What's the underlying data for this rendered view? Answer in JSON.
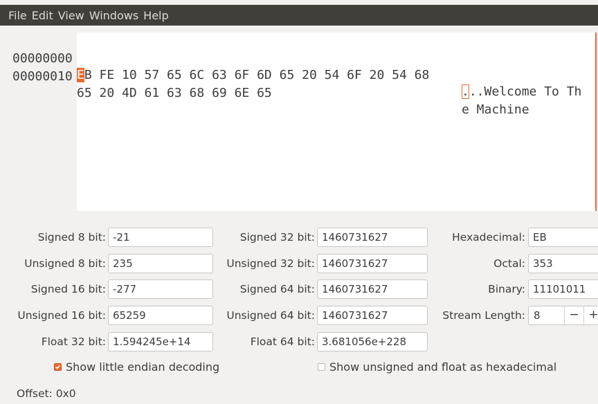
{
  "menu": [
    "File",
    "Edit",
    "View",
    "Windows",
    "Help"
  ],
  "hex": {
    "rows": [
      {
        "offset": "00000000",
        "first_byte": "E",
        "hex_rest": "B FE 10 57 65 6C 63 6F 6D 65 20 54 6F 20 54 68",
        "ascii_first": ".",
        "ascii_rest": "..Welcome To Th"
      },
      {
        "offset": "00000010",
        "hex_rest": "65 20 4D 61 63 68 69 6E 65",
        "ascii_rest": "e Machine"
      }
    ]
  },
  "fields": {
    "signed8": {
      "label": "Signed 8 bit:",
      "value": "-21"
    },
    "unsigned8": {
      "label": "Unsigned 8 bit:",
      "value": "235"
    },
    "signed16": {
      "label": "Signed 16 bit:",
      "value": "-277"
    },
    "unsigned16": {
      "label": "Unsigned 16 bit:",
      "value": "65259"
    },
    "float32": {
      "label": "Float 32 bit:",
      "value": "1.594245e+14"
    },
    "signed32": {
      "label": "Signed 32 bit:",
      "value": "1460731627"
    },
    "unsigned32": {
      "label": "Unsigned 32 bit:",
      "value": "1460731627"
    },
    "signed64": {
      "label": "Signed 64 bit:",
      "value": "1460731627"
    },
    "unsigned64": {
      "label": "Unsigned 64 bit:",
      "value": "1460731627"
    },
    "float64": {
      "label": "Float 64 bit:",
      "value": "3.681056e+228"
    },
    "hexadecimal": {
      "label": "Hexadecimal:",
      "value": "EB"
    },
    "octal": {
      "label": "Octal:",
      "value": "353"
    },
    "binary": {
      "label": "Binary:",
      "value": "11101011"
    },
    "stream_length": {
      "label": "Stream Length:",
      "value": "8",
      "minus": "−",
      "plus": "+"
    }
  },
  "options": {
    "little_endian": {
      "label": "Show little endian decoding",
      "checked": true
    },
    "unsigned_hex": {
      "label": "Show unsigned and float as hexadecimal",
      "checked": false
    }
  },
  "status": {
    "offset": "Offset: 0x0"
  },
  "colors": {
    "accent": "#e96a2c",
    "menubar": "#403f3a"
  }
}
